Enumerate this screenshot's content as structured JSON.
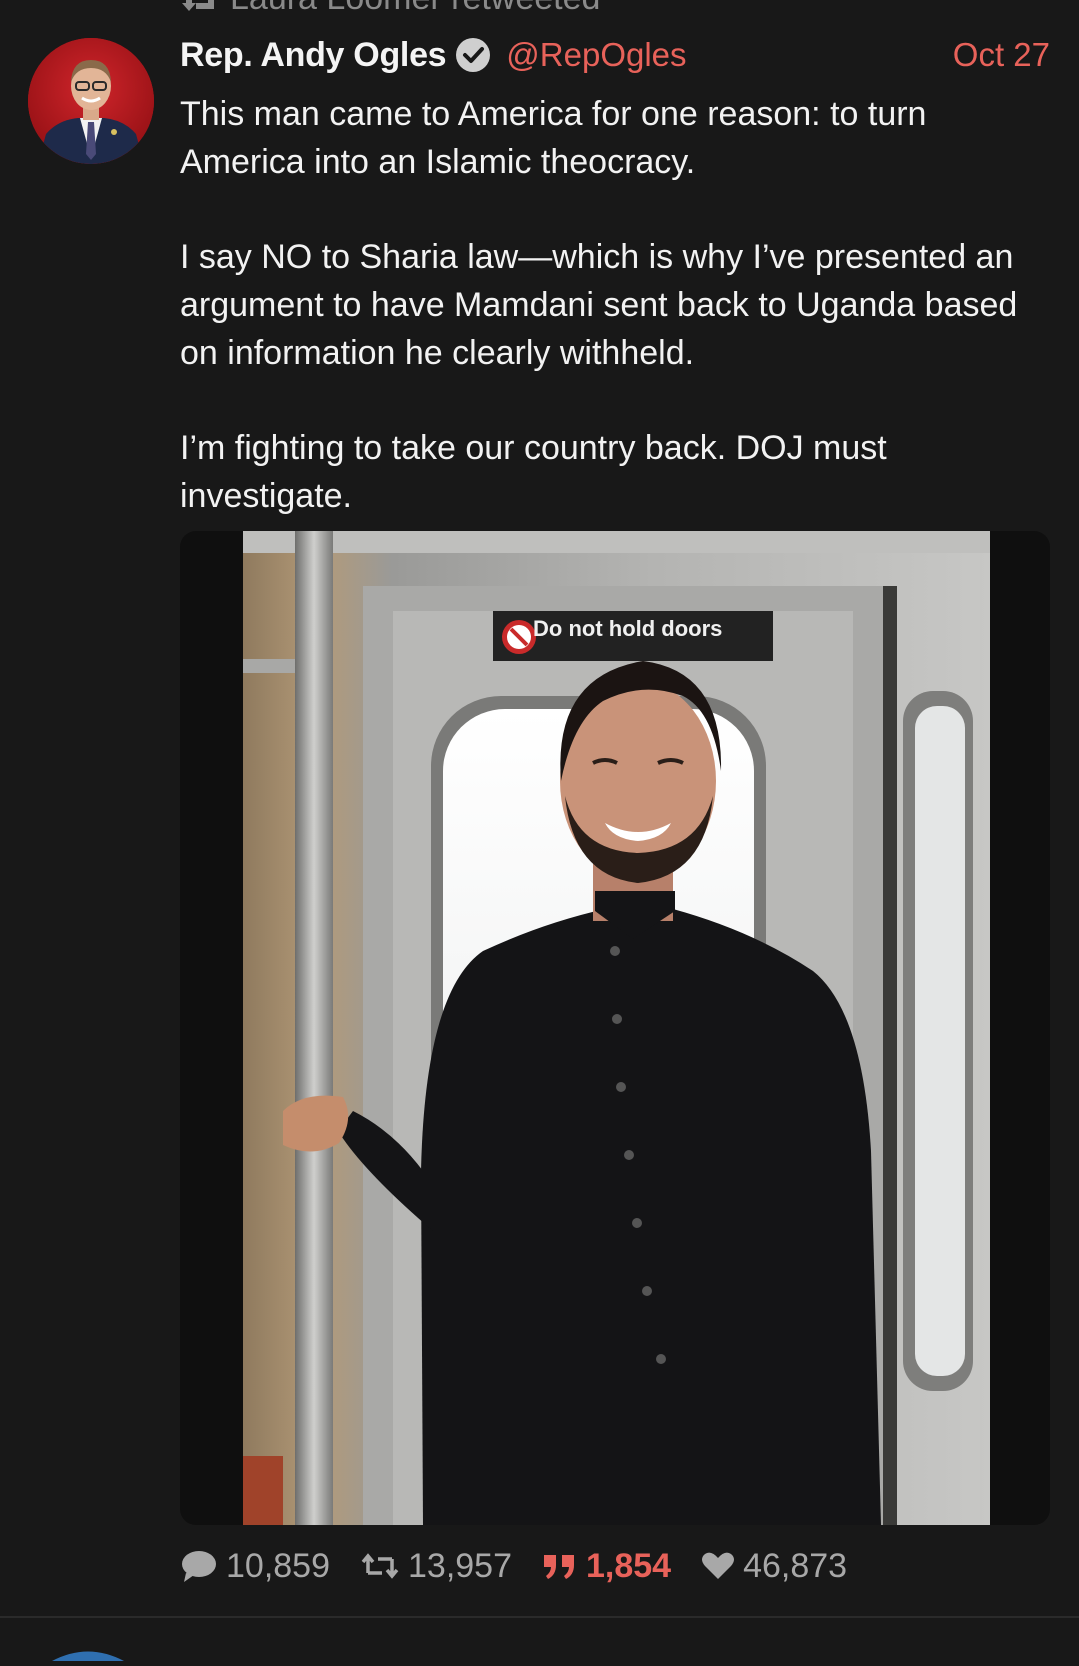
{
  "retweet_context": {
    "text": "Laura Loomer retweeted",
    "icon": "retweet-icon"
  },
  "tweet": {
    "author": {
      "display_name": "Rep. Andy Ogles",
      "handle": "@RepOgles",
      "verified": true,
      "avatar_icon": "avatar-photo"
    },
    "date": "Oct 27",
    "paragraphs": [
      "This man came to America for one reason: to turn America into an Islamic theocracy.",
      "I say NO to Sharia law—which is why I’ve presented an argument to have Mamdani sent back to Uganda based on information he clearly withheld.",
      "I’m fighting to take our country back. DOJ must investigate."
    ],
    "media": {
      "sign_text": "Do not hold doors"
    },
    "stats": {
      "replies": "10,859",
      "retweets": "13,957",
      "quotes": "1,854",
      "likes": "46,873"
    }
  },
  "colors": {
    "background": "#181818",
    "accent": "#e8625a",
    "text": "#f2f2f2",
    "muted": "#a8a8a8"
  }
}
